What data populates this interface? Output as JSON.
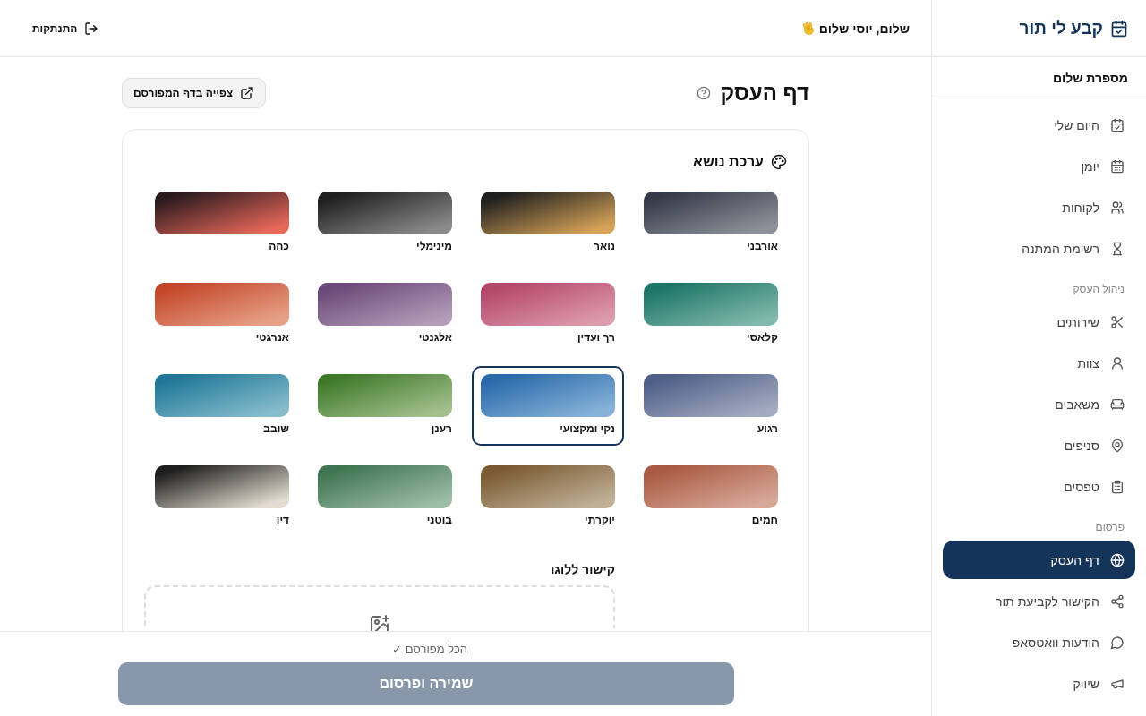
{
  "sidebar": {
    "brand": "קבע לי תור",
    "business": "מספרת שלום",
    "sections": [
      {
        "items": [
          {
            "label": "היום שלי",
            "selected": false
          },
          {
            "label": "יומן",
            "selected": false
          },
          {
            "label": "לקוחות",
            "selected": false
          },
          {
            "label": "רשימת המתנה",
            "selected": false
          }
        ]
      },
      {
        "title": "ניהול העסק",
        "items": [
          {
            "label": "שירותים",
            "selected": false
          },
          {
            "label": "צוות",
            "selected": false
          },
          {
            "label": "משאבים",
            "selected": false
          },
          {
            "label": "סניפים",
            "selected": false
          },
          {
            "label": "טפסים",
            "selected": false
          }
        ]
      },
      {
        "title": "פרסום",
        "items": [
          {
            "label": "דף העסק",
            "selected": true
          },
          {
            "label": "הקישור לקביעת תור",
            "selected": false
          },
          {
            "label": "הודעות וואטסאפ",
            "selected": false
          },
          {
            "label": "שיווק",
            "selected": false
          }
        ]
      }
    ]
  },
  "header": {
    "greeting": "שלום, יוסי שלום",
    "logout": "התנתקות"
  },
  "page": {
    "title": "דף העסק",
    "view_button": "צפייה בדף המפורסם"
  },
  "theme": {
    "title": "ערכת נושא",
    "themes": [
      {
        "name": "אורבני",
        "gradient": [
          {
            "color": "#343a48"
          },
          {
            "color": "#8e9199"
          }
        ],
        "selected": false
      },
      {
        "name": "נואר",
        "gradient": [
          {
            "color": "#1f1f1f"
          },
          {
            "color": "#d6a358"
          }
        ],
        "selected": false
      },
      {
        "name": "מינימלי",
        "gradient": [
          {
            "color": "#1f1f1f"
          },
          {
            "color": "#8a8a8a"
          }
        ],
        "selected": false
      },
      {
        "name": "כהה",
        "gradient": [
          {
            "color": "#2a1a1e"
          },
          {
            "color": "#e8685a"
          }
        ],
        "selected": false
      },
      {
        "name": "קלאסי",
        "gradient": [
          {
            "color": "#1c7566"
          },
          {
            "color": "#80b8ac"
          }
        ],
        "selected": false
      },
      {
        "name": "רך ועדין",
        "gradient": [
          {
            "color": "#b5476a"
          },
          {
            "color": "#dc9aad"
          }
        ],
        "selected": false
      },
      {
        "name": "אלגנטי",
        "gradient": [
          {
            "color": "#6a4a78"
          },
          {
            "color": "#b49bb8"
          }
        ],
        "selected": false
      },
      {
        "name": "אנרגטי",
        "gradient": [
          {
            "color": "#c4472a"
          },
          {
            "color": "#e6a086"
          }
        ],
        "selected": false
      },
      {
        "name": "רגוע",
        "gradient": [
          {
            "color": "#4f5f88"
          },
          {
            "color": "#a3aac0"
          }
        ],
        "selected": false
      },
      {
        "name": "נקי ומקצועי",
        "gradient": [
          {
            "color": "#2a6aaa"
          },
          {
            "color": "#86b2d8"
          }
        ],
        "selected": true
      },
      {
        "name": "רענן",
        "gradient": [
          {
            "color": "#3e7a2a"
          },
          {
            "color": "#a2bf8c"
          }
        ],
        "selected": false
      },
      {
        "name": "שובב",
        "gradient": [
          {
            "color": "#1f7898"
          },
          {
            "color": "#86bccc"
          }
        ],
        "selected": false
      },
      {
        "name": "חמים",
        "gradient": [
          {
            "color": "#a85a42"
          },
          {
            "color": "#d8a898"
          }
        ],
        "selected": false
      },
      {
        "name": "יוקרתי",
        "gradient": [
          {
            "color": "#7a5a32"
          },
          {
            "color": "#c0b096"
          }
        ],
        "selected": false
      },
      {
        "name": "בוטני",
        "gradient": [
          {
            "color": "#3f7552"
          },
          {
            "color": "#9cbca6"
          }
        ],
        "selected": false
      },
      {
        "name": "דיו",
        "gradient": [
          {
            "color": "#1e1e1e"
          },
          {
            "color": "#e4ddd0"
          }
        ],
        "selected": false
      }
    ]
  },
  "logo": {
    "label": "קישור ללוגו"
  },
  "publish_bar": {
    "status": "הכל מפורסם ✓",
    "button": "שמירה ופרסום",
    "disabled": true
  }
}
